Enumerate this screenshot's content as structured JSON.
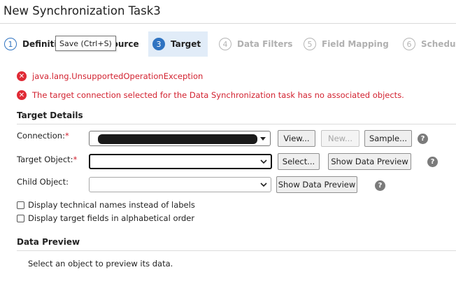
{
  "header": {
    "title": "New Synchronization Task3"
  },
  "steps": [
    {
      "num": "1",
      "label": "Definition"
    },
    {
      "num": "2",
      "label": "Source"
    },
    {
      "num": "3",
      "label": "Target"
    },
    {
      "num": "4",
      "label": "Data Filters"
    },
    {
      "num": "5",
      "label": "Field Mapping"
    },
    {
      "num": "6",
      "label": "Schedule"
    }
  ],
  "tooltip": {
    "text": "Save (Ctrl+S)"
  },
  "errors": [
    "java.lang.UnsupportedOperationException",
    "The target connection selected for the Data Synchronization task has no associated objects."
  ],
  "target_details": {
    "heading": "Target Details",
    "connection_label": "Connection:",
    "target_object_label": "Target Object:",
    "child_object_label": "Child Object:",
    "required_mark": "*",
    "view_button": "View...",
    "new_button": "New...",
    "sample_button": "Sample...",
    "select_button": "Select...",
    "show_data_preview_button": "Show Data Preview",
    "help_glyph": "?",
    "option_technical_names": "Display technical names instead of labels",
    "option_alphabetical": "Display target fields in alphabetical order"
  },
  "data_preview": {
    "heading": "Data Preview",
    "hint": "Select an object to preview its data."
  },
  "colors": {
    "accent": "#2f73c1",
    "error": "#d22230",
    "active_step_bg": "#e1ecf8"
  }
}
